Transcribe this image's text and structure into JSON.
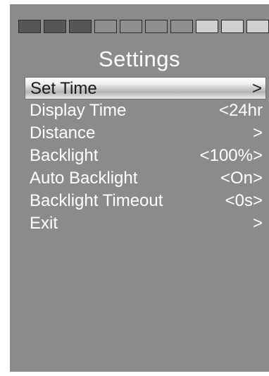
{
  "battery": {
    "segments": [
      "dark",
      "dark",
      "dark",
      "mid",
      "mid",
      "mid",
      "mid",
      "light",
      "light",
      "light"
    ]
  },
  "title": "Settings",
  "menu": [
    {
      "label": "Set Time",
      "value": ">",
      "selected": true
    },
    {
      "label": "Display Time",
      "value": "<24hr",
      "selected": false
    },
    {
      "label": "Distance",
      "value": ">",
      "selected": false
    },
    {
      "label": "Backlight",
      "value": "<100%>",
      "selected": false
    },
    {
      "label": "Auto Backlight",
      "value": "<On>",
      "selected": false
    },
    {
      "label": "Backlight Timeout",
      "value": "<0s>",
      "selected": false
    },
    {
      "label": "Exit",
      "value": ">",
      "selected": false
    }
  ]
}
